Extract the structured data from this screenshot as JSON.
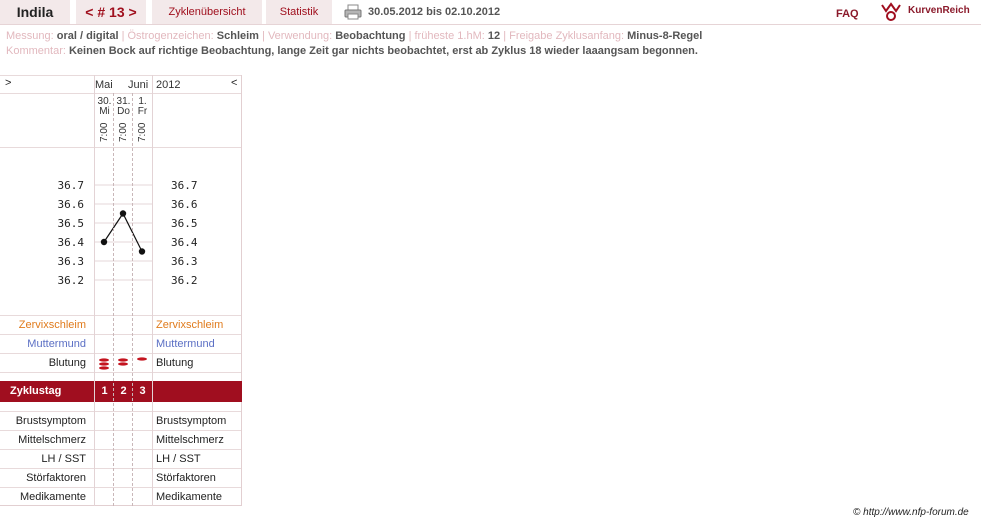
{
  "nav": {
    "user": "Indila",
    "cycle": "< # 13 >",
    "overview": "Zyklenübersicht",
    "stats": "Statistik",
    "daterange": "30.05.2012 bis 02.10.2012",
    "faq": "FAQ",
    "brand": "KurvenReich"
  },
  "info": {
    "messung_label": "Messung:",
    "messung": "oral / digital",
    "oestrogen_label": "Östrogenzeichen:",
    "oestrogen": "Schleim",
    "verwendung_label": "Verwendung:",
    "verwendung": "Beobachtung",
    "hm_label": "früheste 1.hM:",
    "hm": "12",
    "freigabe_label": "Freigabe Zyklusanfang:",
    "freigabe": "Minus-8-Regel",
    "kommentar_label": "Kommentar:",
    "kommentar": "Keinen Bock auf richtige Beobachtung, lange Zeit gar nichts beobachtet, erst ab Zyklus 18 wieder laaangsam begonnen."
  },
  "grid": {
    "prev": ">",
    "next": "<",
    "month1": "Mai",
    "month2": "Juni",
    "year": "2012",
    "days": [
      {
        "date": "30.",
        "wd": "Mi",
        "time": "7:00",
        "zyklustag": "1"
      },
      {
        "date": "31.",
        "wd": "Do",
        "time": "7:00",
        "zyklustag": "2"
      },
      {
        "date": "1.",
        "wd": "Fr",
        "time": "7:00",
        "zyklustag": "3"
      }
    ],
    "temp_ticks": [
      "36.7",
      "36.6",
      "36.5",
      "36.4",
      "36.3",
      "36.2"
    ],
    "temperatures": [
      36.4,
      36.55,
      36.35
    ],
    "rows": {
      "zervix": "Zervixschleim",
      "muttermund": "Muttermund",
      "blutung": "Blutung",
      "zyklustag": "Zyklustag",
      "brust": "Brustsymptom",
      "mittel": "Mittelschmerz",
      "lh": "LH / SST",
      "stoer": "Störfaktoren",
      "medi": "Medikamente"
    },
    "colors": {
      "zervix": "#e07b1c",
      "muttermund": "#5b6fc4",
      "accent": "#a00e1f"
    }
  },
  "footer": {
    "copyright": "© http://www.nfp-forum.de"
  }
}
